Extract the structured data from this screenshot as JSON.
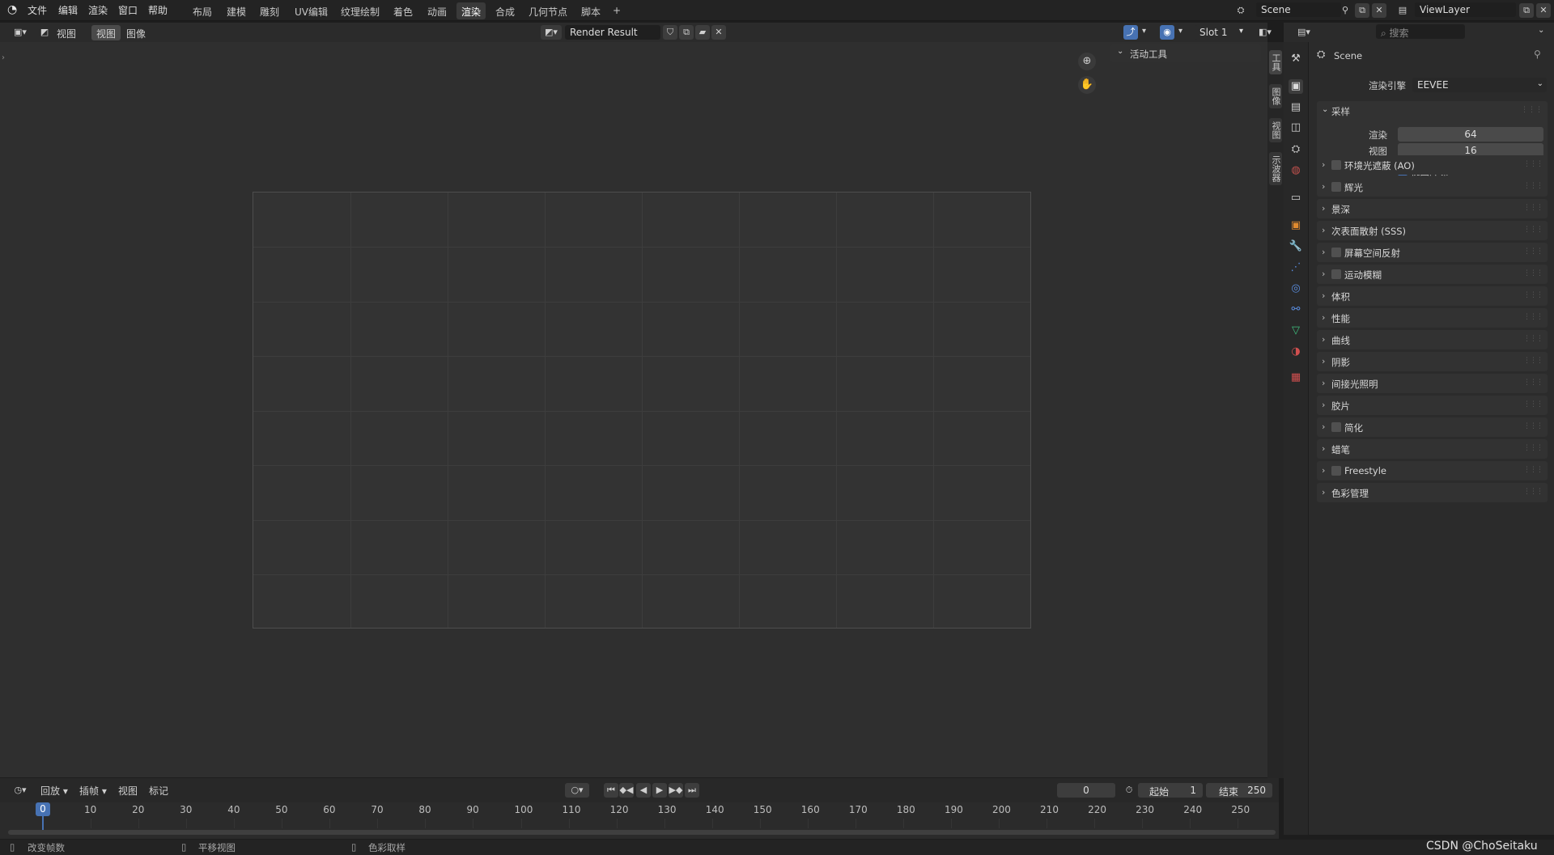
{
  "topbar": {
    "menu": [
      "文件",
      "编辑",
      "渲染",
      "窗口",
      "帮助"
    ],
    "workspaces": [
      "布局",
      "建模",
      "雕刻",
      "UV编辑",
      "纹理绘制",
      "着色",
      "动画",
      "渲染",
      "合成",
      "几何节点",
      "脚本"
    ],
    "active_workspace": "渲染",
    "add_tab": "+",
    "scene_name": "Scene",
    "view_layer": "ViewLayer"
  },
  "image_editor": {
    "menus": [
      "视图",
      "视图",
      "图像"
    ],
    "image_name": "Render Result",
    "slot": "Slot 1",
    "npanel_section": "活动工具",
    "side_tabs": [
      "工具",
      "图像",
      "视图",
      "示波器"
    ]
  },
  "properties": {
    "scene_label": "Scene",
    "render_engine_label": "渲染引擎",
    "render_engine": "EEVEE",
    "sampling": {
      "title": "采样",
      "render_label": "渲染",
      "render_value": "64",
      "viewport_label": "视图",
      "viewport_value": "16",
      "denoise_label": "视图降噪"
    },
    "sections": [
      {
        "label": "环境光遮蔽 (AO)",
        "checkbox": true
      },
      {
        "label": "辉光",
        "checkbox": true
      },
      {
        "label": "景深",
        "checkbox": false
      },
      {
        "label": "次表面散射 (SSS)",
        "checkbox": false
      },
      {
        "label": "屏幕空间反射",
        "checkbox": true
      },
      {
        "label": "运动模糊",
        "checkbox": true
      },
      {
        "label": "体积",
        "checkbox": false
      },
      {
        "label": "性能",
        "checkbox": false
      },
      {
        "label": "曲线",
        "checkbox": false
      },
      {
        "label": "阴影",
        "checkbox": false
      },
      {
        "label": "间接光照明",
        "checkbox": false
      },
      {
        "label": "胶片",
        "checkbox": false
      },
      {
        "label": "简化",
        "checkbox": true
      },
      {
        "label": "蜡笔",
        "checkbox": false
      },
      {
        "label": "Freestyle",
        "checkbox": true
      },
      {
        "label": "色彩管理",
        "checkbox": false
      }
    ],
    "search_placeholder": "搜索"
  },
  "timeline": {
    "menus": [
      "回放",
      "插帧",
      "视图",
      "标记"
    ],
    "current_frame": "0",
    "start_label": "起始",
    "start_value": "1",
    "end_label": "结束",
    "end_value": "250",
    "ticks": [
      "0",
      "10",
      "20",
      "30",
      "40",
      "50",
      "60",
      "70",
      "80",
      "90",
      "100",
      "110",
      "120",
      "130",
      "140",
      "150",
      "160",
      "170",
      "180",
      "190",
      "200",
      "210",
      "220",
      "230",
      "240",
      "250"
    ]
  },
  "statusbar": {
    "items": [
      "改变帧数",
      "平移视图",
      "色彩取样"
    ],
    "watermark": "CSDN @ChoSeitaku"
  },
  "colors": {
    "accent": "#4772b3",
    "background": "#2f2f2f"
  }
}
